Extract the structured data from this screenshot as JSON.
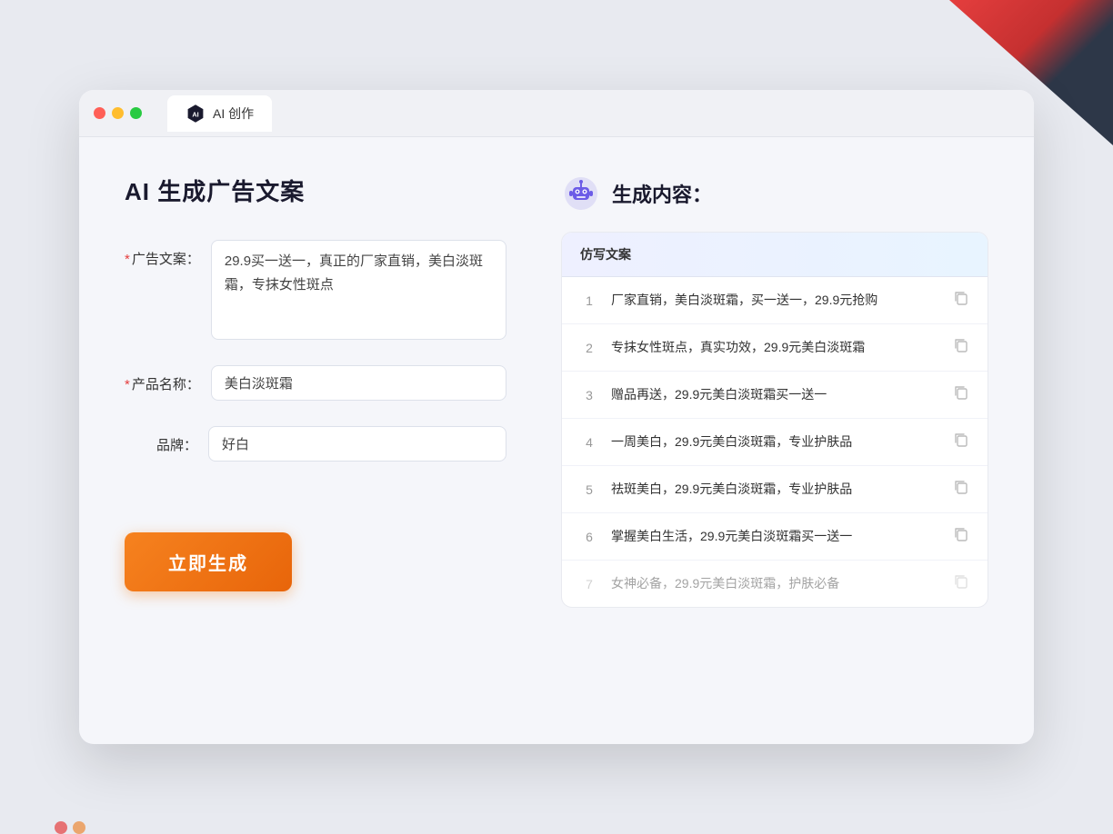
{
  "browser": {
    "tab_label": "AI 创作"
  },
  "page": {
    "title": "AI 生成广告文案",
    "form": {
      "ad_copy_label": "广告文案：",
      "ad_copy_required": "*",
      "ad_copy_value": "29.9买一送一，真正的厂家直销，美白淡斑霜，专抹女性斑点",
      "product_name_label": "产品名称：",
      "product_name_required": "*",
      "product_name_value": "美白淡斑霜",
      "brand_label": "品牌：",
      "brand_value": "好白",
      "generate_button": "立即生成"
    },
    "result": {
      "header_icon": "robot",
      "header_title": "生成内容：",
      "column_label": "仿写文案",
      "items": [
        {
          "id": 1,
          "text": "厂家直销，美白淡斑霜，买一送一，29.9元抢购",
          "faded": false
        },
        {
          "id": 2,
          "text": "专抹女性斑点，真实功效，29.9元美白淡斑霜",
          "faded": false
        },
        {
          "id": 3,
          "text": "赠品再送，29.9元美白淡斑霜买一送一",
          "faded": false
        },
        {
          "id": 4,
          "text": "一周美白，29.9元美白淡斑霜，专业护肤品",
          "faded": false
        },
        {
          "id": 5,
          "text": "祛斑美白，29.9元美白淡斑霜，专业护肤品",
          "faded": false
        },
        {
          "id": 6,
          "text": "掌握美白生活，29.9元美白淡斑霜买一送一",
          "faded": false
        },
        {
          "id": 7,
          "text": "女神必备，29.9元美白淡斑霜，护肤必备",
          "faded": true
        }
      ]
    }
  }
}
